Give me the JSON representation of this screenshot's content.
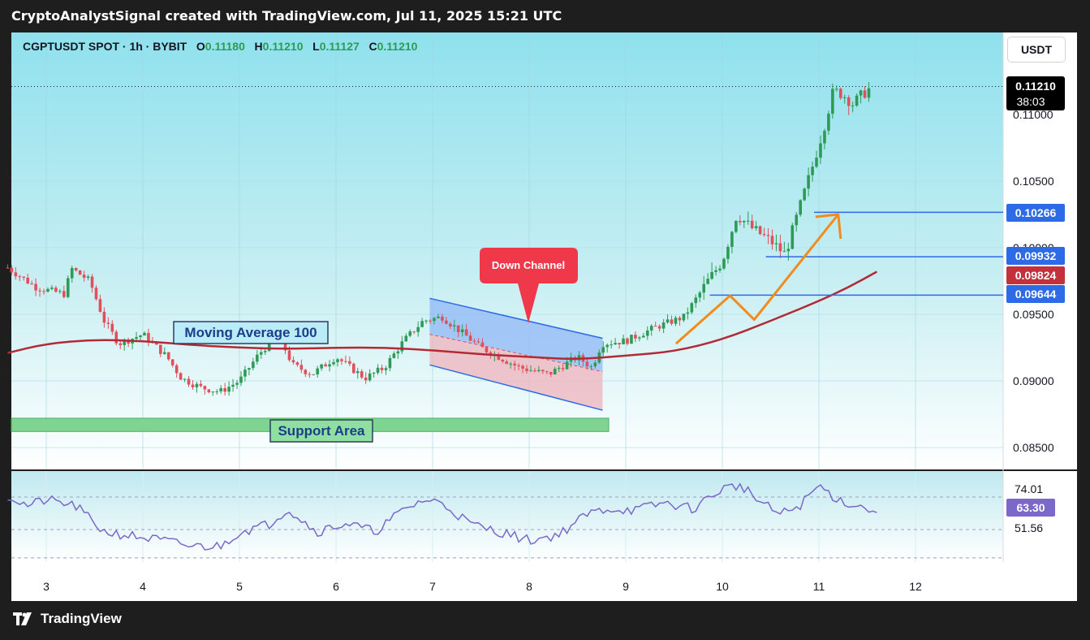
{
  "header": {
    "caption": "CryptoAnalystSignal created with TradingView.com, Jul 11, 2025 15:21 UTC"
  },
  "legend": {
    "symbol": "CGPTUSDT SPOT · 1h · BYBIT",
    "o_label": "O",
    "o_value": "0.11180",
    "h_label": "H",
    "h_value": "0.11210",
    "l_label": "L",
    "l_value": "0.11127",
    "c_label": "C",
    "c_value": "0.11210"
  },
  "currency_button": "USDT",
  "annotations": {
    "down_channel": "Down Channel",
    "moving_average": "Moving Average 100",
    "support_area": "Support Area"
  },
  "price_badges": {
    "last_price": "0.11210",
    "countdown": "38:03",
    "level_1": "0.10266",
    "level_2": "0.09932",
    "ma_value": "0.09824",
    "level_3": "0.09644"
  },
  "rsi_labels": {
    "upper": "74.01",
    "current": "63.30",
    "lower": "51.56"
  },
  "footer": {
    "brand": "TradingView"
  },
  "colors": {
    "bg_top": "#8fe1ee",
    "bg_bottom": "#ffffff",
    "up": "#2e9b55",
    "down": "#e0505c",
    "ma": "#b22a35",
    "level": "#2d6ae6",
    "orange": "#f28a1c",
    "rsi": "#7b68c8",
    "badge_red": "#c2313c"
  },
  "chart_data": {
    "type": "candlestick",
    "y_axis_ticks": [
      "0.11000",
      "0.10500",
      "0.10000",
      "0.09500",
      "0.09000",
      "0.08500"
    ],
    "x_axis_ticks": [
      "3",
      "4",
      "5",
      "6",
      "7",
      "8",
      "9",
      "10",
      "11",
      "12"
    ],
    "ylim": [
      0.0825,
      0.1145
    ],
    "horizontal_levels": [
      0.10266,
      0.09932,
      0.09644
    ],
    "last_price": 0.1121,
    "ma100_last": 0.09824,
    "support_area": [
      0.0862,
      0.0872
    ],
    "ohlc_path": [
      [
        2.6,
        0.0985
      ],
      [
        2.9,
        0.097
      ],
      [
        3.2,
        0.0965
      ],
      [
        3.25,
        0.0985
      ],
      [
        3.45,
        0.0975
      ],
      [
        3.6,
        0.0945
      ],
      [
        3.75,
        0.0928
      ],
      [
        4.0,
        0.0935
      ],
      [
        4.25,
        0.0918
      ],
      [
        4.4,
        0.0902
      ],
      [
        4.6,
        0.0895
      ],
      [
        4.8,
        0.0892
      ],
      [
        5.0,
        0.09
      ],
      [
        5.2,
        0.092
      ],
      [
        5.4,
        0.0935
      ],
      [
        5.55,
        0.0912
      ],
      [
        5.75,
        0.0905
      ],
      [
        6.0,
        0.0918
      ],
      [
        6.3,
        0.0902
      ],
      [
        6.5,
        0.091
      ],
      [
        6.7,
        0.093
      ],
      [
        6.9,
        0.0945
      ],
      [
        7.1,
        0.0948
      ],
      [
        7.5,
        0.0925
      ],
      [
        7.9,
        0.091
      ],
      [
        8.2,
        0.0905
      ],
      [
        8.5,
        0.0918
      ],
      [
        8.65,
        0.091
      ],
      [
        8.75,
        0.0928
      ],
      [
        9.0,
        0.093
      ],
      [
        9.3,
        0.094
      ],
      [
        9.6,
        0.0948
      ],
      [
        9.85,
        0.0975
      ],
      [
        10.0,
        0.099
      ],
      [
        10.15,
        0.1025
      ],
      [
        10.3,
        0.1015
      ],
      [
        10.5,
        0.1005
      ],
      [
        10.65,
        0.0995
      ],
      [
        10.8,
        0.103
      ],
      [
        10.95,
        0.1065
      ],
      [
        11.05,
        0.109
      ],
      [
        11.15,
        0.1118
      ],
      [
        11.25,
        0.1115
      ],
      [
        11.35,
        0.1108
      ],
      [
        11.45,
        0.1115
      ],
      [
        11.55,
        0.1121
      ]
    ],
    "ma100_path": [
      [
        2.6,
        0.0921
      ],
      [
        3.0,
        0.0928
      ],
      [
        3.5,
        0.0931
      ],
      [
        4.0,
        0.093
      ],
      [
        4.5,
        0.0927
      ],
      [
        5.0,
        0.0925
      ],
      [
        5.5,
        0.0924
      ],
      [
        6.0,
        0.0925
      ],
      [
        6.5,
        0.0925
      ],
      [
        7.0,
        0.0923
      ],
      [
        7.5,
        0.092
      ],
      [
        8.0,
        0.0918
      ],
      [
        8.5,
        0.0916
      ],
      [
        9.0,
        0.0919
      ],
      [
        9.5,
        0.0922
      ],
      [
        10.0,
        0.0931
      ],
      [
        10.5,
        0.0945
      ],
      [
        11.0,
        0.096
      ],
      [
        11.3,
        0.097
      ],
      [
        11.6,
        0.0982
      ]
    ],
    "rsi": {
      "ylim": [
        30,
        90
      ],
      "upper_band": 74.01,
      "lower_band": 51.56,
      "current": 63.3,
      "path": [
        [
          2.6,
          75
        ],
        [
          2.8,
          68
        ],
        [
          3.0,
          72
        ],
        [
          3.3,
          68
        ],
        [
          3.6,
          50
        ],
        [
          3.9,
          47
        ],
        [
          4.2,
          44
        ],
        [
          4.5,
          40
        ],
        [
          4.8,
          40
        ],
        [
          5.0,
          50
        ],
        [
          5.3,
          55
        ],
        [
          5.5,
          66
        ],
        [
          5.8,
          50
        ],
        [
          6.1,
          56
        ],
        [
          6.4,
          50
        ],
        [
          6.7,
          65
        ],
        [
          6.9,
          72
        ],
        [
          7.1,
          70
        ],
        [
          7.4,
          55
        ],
        [
          7.7,
          50
        ],
        [
          8.0,
          44
        ],
        [
          8.3,
          48
        ],
        [
          8.6,
          62
        ],
        [
          8.8,
          66
        ],
        [
          9.1,
          65
        ],
        [
          9.4,
          70
        ],
        [
          9.7,
          66
        ],
        [
          10.0,
          80
        ],
        [
          10.2,
          82
        ],
        [
          10.4,
          70
        ],
        [
          10.6,
          62
        ],
        [
          10.8,
          68
        ],
        [
          11.0,
          82
        ],
        [
          11.2,
          72
        ],
        [
          11.4,
          68
        ],
        [
          11.6,
          63.3
        ]
      ]
    }
  }
}
